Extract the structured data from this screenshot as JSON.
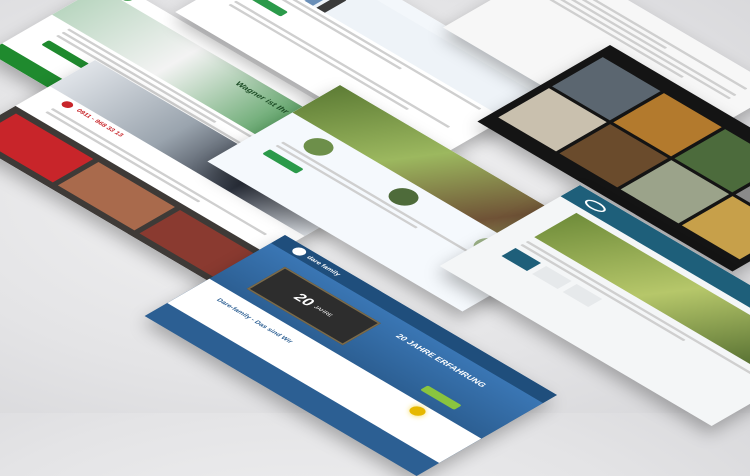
{
  "mockups": [
    {
      "id": "green-company-site",
      "theme_color": "#1f8a2e",
      "tagline": "Wagner ist Ihr Partner"
    },
    {
      "id": "blue-team-site",
      "theme_color": "#2f6fb3"
    },
    {
      "id": "light-grey-site",
      "theme_color": "#d23b3b"
    },
    {
      "id": "business-people-site",
      "theme_color": "#c8252a",
      "phone": "0911 - 968 33 13"
    },
    {
      "id": "garden-site",
      "theme_color": "#2b9a4a"
    },
    {
      "id": "dark-gallery-site",
      "theme_color": "#1a1a1a"
    },
    {
      "id": "family-business-site",
      "theme_color": "#2c5f93",
      "headline": "20 JAHRE ERFAHRUNG",
      "counter": "20",
      "counter_label": "JAHRE",
      "slogan": "Dare-family - Das sind Wir",
      "logo_text": "dare family"
    },
    {
      "id": "teal-logo-site",
      "theme_color": "#1e5f7a"
    }
  ],
  "colors": {
    "background": "#e6e6e8",
    "accent_green": "#1f8a2e",
    "accent_blue": "#2c5f93",
    "accent_red": "#c8252a",
    "accent_gold": "#e6b800"
  }
}
